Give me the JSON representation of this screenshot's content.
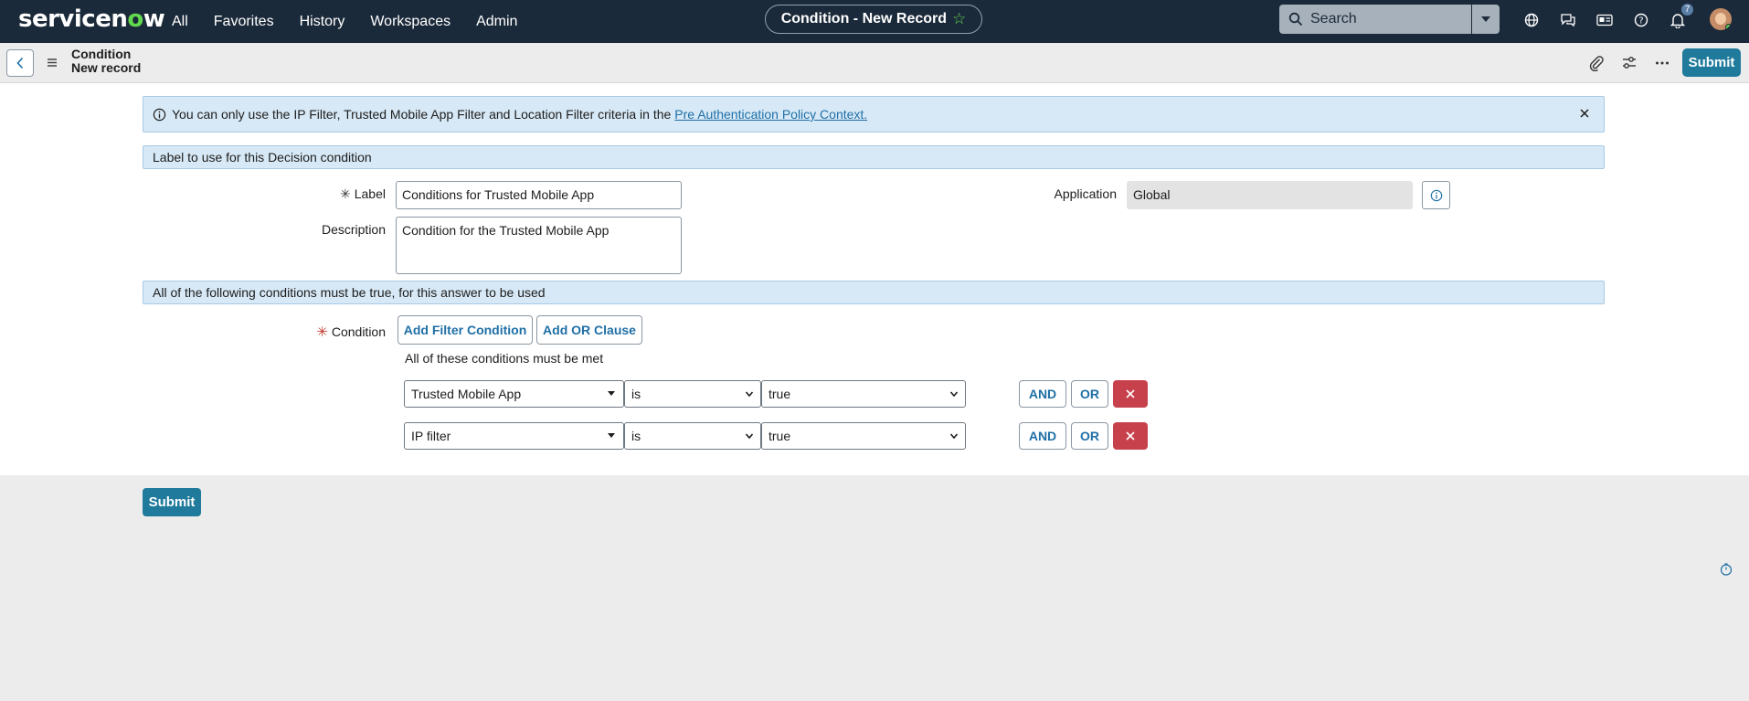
{
  "nav": {
    "logo_pre": "servicen",
    "logo_o": "o",
    "logo_post": "w",
    "links": [
      "All",
      "Favorites",
      "History",
      "Workspaces",
      "Admin"
    ],
    "record_title": "Condition - New Record",
    "search_placeholder": "Search",
    "notification_count": "7",
    "icons": [
      "globe-icon",
      "chat-icon",
      "id-card-icon",
      "help-icon",
      "bell-icon"
    ]
  },
  "form_header": {
    "title_line1": "Condition",
    "title_line2": "New record",
    "submit_label": "Submit"
  },
  "info_banner": {
    "text": "You can only use the IP Filter, Trusted Mobile App Filter and Location Filter criteria in the",
    "link": "Pre Authentication Policy Context."
  },
  "sections": {
    "label_section": "Label to use for this Decision condition",
    "conditions_section": "All of the following conditions must be true, for this answer to be used"
  },
  "fields": {
    "label_label": "Label",
    "label_value": "Conditions for Trusted Mobile App",
    "description_label": "Description",
    "description_value": "Condition for the Trusted Mobile App",
    "application_label": "Application",
    "application_value": "Global",
    "condition_label": "Condition"
  },
  "condition_builder": {
    "add_filter_label": "Add Filter Condition",
    "add_or_label": "Add OR Clause",
    "all_met_text": "All of these conditions must be met",
    "rows": [
      {
        "field": "Trusted Mobile App",
        "operator": "is",
        "value": "true",
        "and": "AND",
        "or": "OR"
      },
      {
        "field": "IP filter",
        "operator": "is",
        "value": "true",
        "and": "AND",
        "or": "OR"
      }
    ]
  },
  "bottom": {
    "submit_label": "Submit"
  },
  "colors": {
    "nav_bg": "#1b2a3a",
    "accent": "#1f7a9b",
    "brand_green": "#62d84e",
    "delete_red": "#c7414d",
    "banner_bg": "#d7e9f6"
  }
}
